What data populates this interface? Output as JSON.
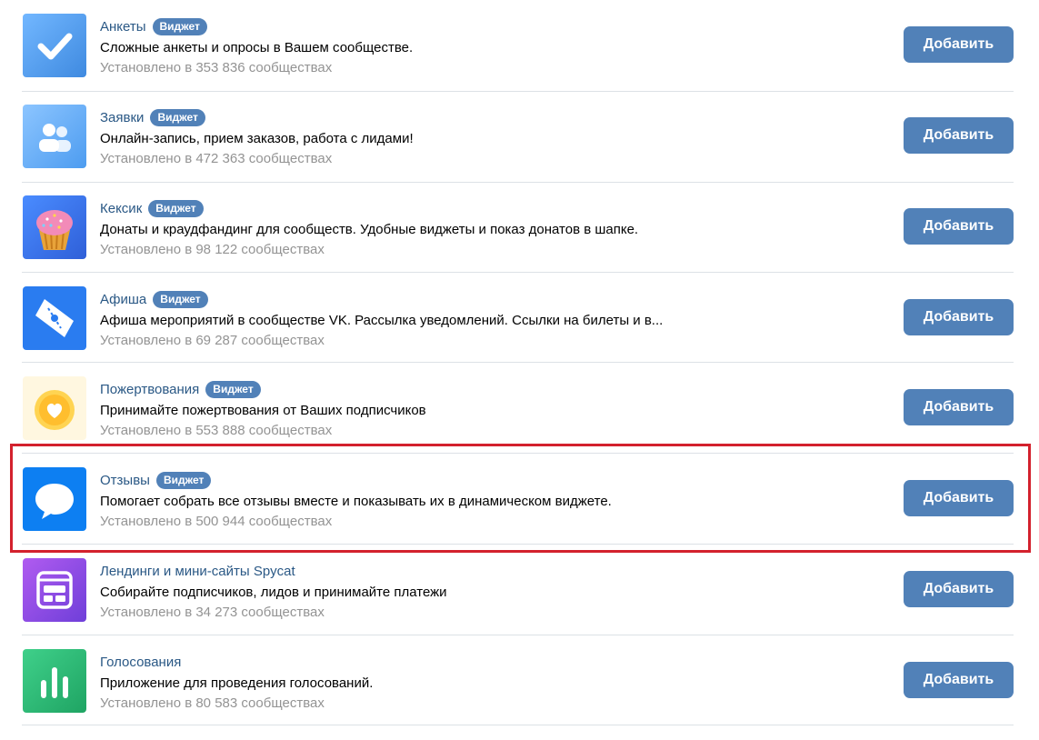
{
  "apps": [
    {
      "title": "Анкеты",
      "badge": "Виджет",
      "description": "Сложные анкеты и опросы в Вашем сообществе.",
      "installs": "Установлено в 353 836 сообществах",
      "button": "Добавить",
      "icon": "checkmark-icon"
    },
    {
      "title": "Заявки",
      "badge": "Виджет",
      "description": "Онлайн-запись, прием заказов, работа с лидами!",
      "installs": "Установлено в 472 363 сообществах",
      "button": "Добавить",
      "icon": "people-icon"
    },
    {
      "title": "Кексик",
      "badge": "Виджет",
      "description": "Донаты и краудфандинг для сообществ. Удобные виджеты и показ донатов в шапке.",
      "installs": "Установлено в 98 122 сообществах",
      "button": "Добавить",
      "icon": "cupcake-icon"
    },
    {
      "title": "Афиша",
      "badge": "Виджет",
      "description": "Афиша мероприятий в сообществе VK. Рассылка уведомлений. Ссылки на билеты и в...",
      "installs": "Установлено в 69 287 сообществах",
      "button": "Добавить",
      "icon": "ticket-icon"
    },
    {
      "title": "Пожертвования",
      "badge": "Виджет",
      "description": "Принимайте пожертвования от Ваших подписчиков",
      "installs": "Установлено в 553 888 сообществах",
      "button": "Добавить",
      "icon": "heart-coin-icon"
    },
    {
      "title": "Отзывы",
      "badge": "Виджет",
      "description": "Помогает собрать все отзывы вместе и показывать их в динамическом виджете.",
      "installs": "Установлено в 500 944 сообществах",
      "button": "Добавить",
      "icon": "speech-bubble-icon"
    },
    {
      "title": "Лендинги и мини-сайты Spycat",
      "badge": "",
      "description": "Собирайте подписчиков, лидов и принимайте платежи",
      "installs": "Установлено в 34 273 сообществах",
      "button": "Добавить",
      "icon": "landing-page-icon"
    },
    {
      "title": "Голосования",
      "badge": "",
      "description": "Приложение для проведения голосований.",
      "installs": "Установлено в 80 583 сообществах",
      "button": "Добавить",
      "icon": "bar-chart-icon"
    }
  ],
  "colors": {
    "accent": "#5181b8",
    "link": "#2a5885",
    "muted": "#939393",
    "highlight": "#d3212d"
  }
}
